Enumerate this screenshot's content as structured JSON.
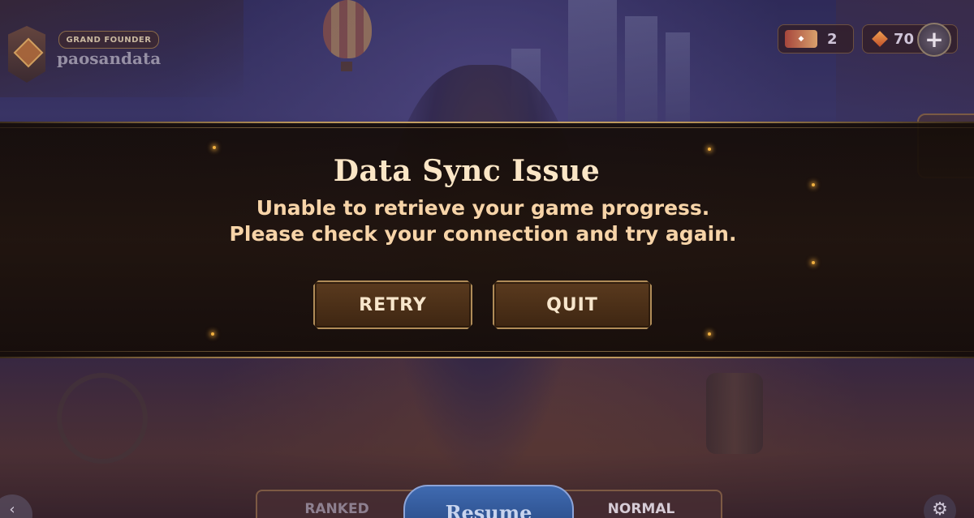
{
  "profile": {
    "rank_title": "GRAND FOUNDER",
    "player_name": "paosandata"
  },
  "currencies": {
    "tickets": "2",
    "gems": "70",
    "add_label": "+"
  },
  "dialog": {
    "title": "Data Sync Issue",
    "message_line1": "Unable to retrieve your game progress.",
    "message_line2": "Please check your connection and try again.",
    "retry_label": "RETRY",
    "quit_label": "QUIT"
  },
  "bottom_bar": {
    "ranked_label": "RANKED",
    "resume_label": "Resume",
    "normal_label": "NORMAL"
  },
  "icons": {
    "back": "arrow-left-icon",
    "settings": "gear-icon",
    "ticket": "ticket-icon",
    "gem": "gem-icon"
  },
  "colors": {
    "accent_gold": "#b08c58",
    "title_cream": "#fbe6c6",
    "message_peach": "#f7d4a8",
    "resume_blue": "#3f6ab0"
  }
}
